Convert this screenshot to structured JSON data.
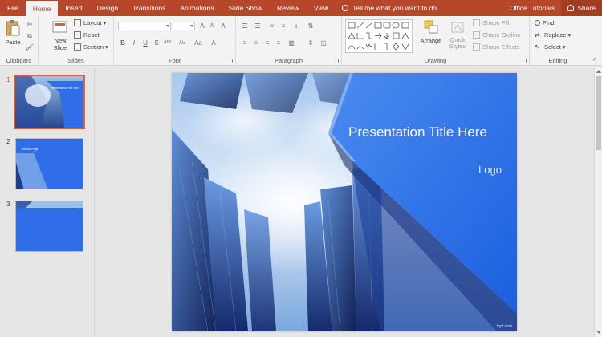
{
  "tabs": [
    "File",
    "Home",
    "Insert",
    "Design",
    "Transitions",
    "Animations",
    "Slide Show",
    "Review",
    "View"
  ],
  "active_tab": "Home",
  "tell_me": "Tell me what you want to do...",
  "office_tutorials": "Office Tutorials",
  "share": "Share",
  "ribbon": {
    "clipboard": {
      "label": "Clipboard",
      "paste": "Paste"
    },
    "slides": {
      "label": "Slides",
      "new_slide": "New Slide",
      "layout": "Layout",
      "reset": "Reset",
      "section": "Section"
    },
    "font": {
      "label": "Font",
      "bold": "B",
      "italic": "I",
      "underline": "U",
      "strike": "S",
      "shadow": "abc",
      "spacing": "AV",
      "aa": "Aa",
      "font_color": "A"
    },
    "paragraph": {
      "label": "Paragraph"
    },
    "drawing": {
      "label": "Drawing",
      "arrange": "Arrange",
      "quick_styles": "Quick Styles",
      "shape_fill": "Shape Fill",
      "shape_outline": "Shape Outline",
      "shape_effects": "Shape Effects"
    },
    "editing": {
      "label": "Editing",
      "find": "Find",
      "replace": "Replace",
      "select": "Select"
    }
  },
  "thumbnails": [
    {
      "number": "1",
      "title": "Presentation Title Here"
    },
    {
      "number": "2",
      "title": "Second Page"
    },
    {
      "number": "3",
      "title": ""
    }
  ],
  "slide": {
    "title": "Presentation Title Here",
    "logo": "Logo",
    "credit": "fppt.com"
  },
  "colors": {
    "accent": "#b7472a",
    "slide_blue": "#2f6ee8"
  }
}
